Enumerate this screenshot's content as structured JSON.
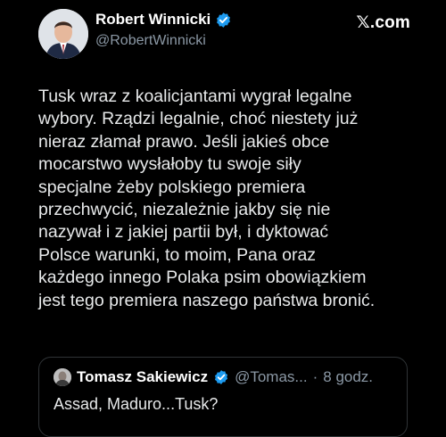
{
  "author": {
    "display_name": "Robert Winnicki",
    "handle": "@RobertWinnicki",
    "verified_icon": "verified-badge-icon",
    "avatar_icon": "profile-photo"
  },
  "brand": "𝕏.com",
  "tweet": {
    "text": "Tusk wraz z koalicjantami wygrał legalne\nwybory. Rządzi legalnie, choć niestety już\nnieraz złamał prawo. Jeśli jakieś obce\nmocarstwo wysłałoby tu swoje siły\nspecjalne żeby polskiego premiera\nprzechwycić, niezależnie jakby się nie\nnazywał i z jakiej partii był, i dyktować\nPolsce warunki, to moim, Pana oraz\nkażdego innego Polaka psim obowiązkiem\njest tego premiera naszego państwa bronić."
  },
  "quoted_tweet": {
    "display_name": "Tomasz Sakiewicz",
    "handle": "@Tomas...",
    "separator": "·",
    "time": "8 godz.",
    "text": "Assad, Maduro...Tusk?",
    "verified_icon": "verified-badge-icon"
  },
  "colors": {
    "background": "#000000",
    "text": "#e7e9ea",
    "secondary_text": "#8b98a5",
    "verified": "#1d9bf0",
    "border": "#2f3336"
  }
}
